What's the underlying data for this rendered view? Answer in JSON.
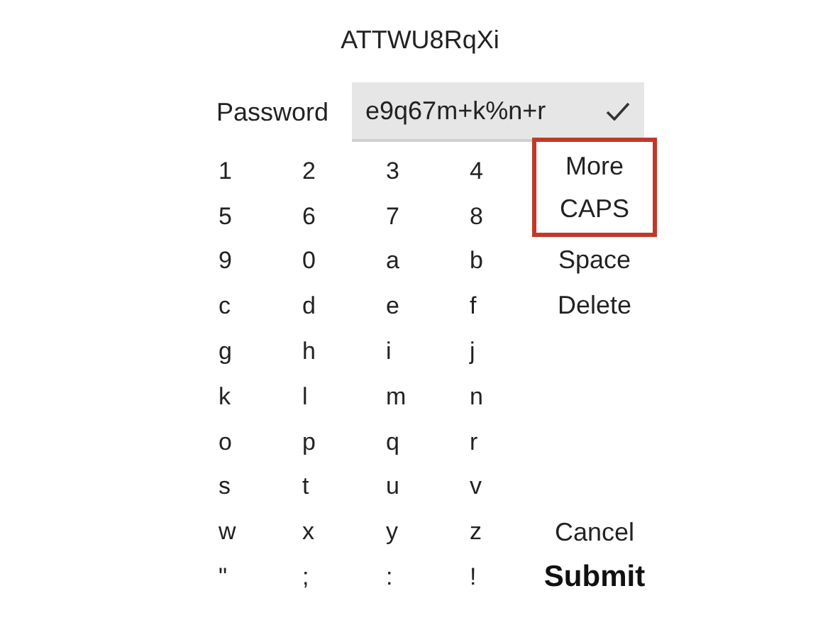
{
  "title": "ATTWU8RqXi",
  "password": {
    "label": "Password",
    "value": "e9q67m+k%n+r",
    "valid": true
  },
  "keys": [
    [
      "1",
      "2",
      "3",
      "4"
    ],
    [
      "5",
      "6",
      "7",
      "8"
    ],
    [
      "9",
      "0",
      "a",
      "b"
    ],
    [
      "c",
      "d",
      "e",
      "f"
    ],
    [
      "g",
      "h",
      "i",
      "j"
    ],
    [
      "k",
      "l",
      "m",
      "n"
    ],
    [
      "o",
      "p",
      "q",
      "r"
    ],
    [
      "s",
      "t",
      "u",
      "v"
    ],
    [
      "w",
      "x",
      "y",
      "z"
    ],
    [
      "\"",
      ";",
      ":",
      "!"
    ]
  ],
  "top_actions": [
    {
      "label": "More",
      "highlighted": true
    },
    {
      "label": "CAPS",
      "highlighted": true
    },
    {
      "label": "Space",
      "highlighted": false
    },
    {
      "label": "Delete",
      "highlighted": false
    }
  ],
  "bottom_actions": [
    {
      "label": "Cancel",
      "kind": "secondary"
    },
    {
      "label": "Submit",
      "kind": "primary"
    }
  ]
}
